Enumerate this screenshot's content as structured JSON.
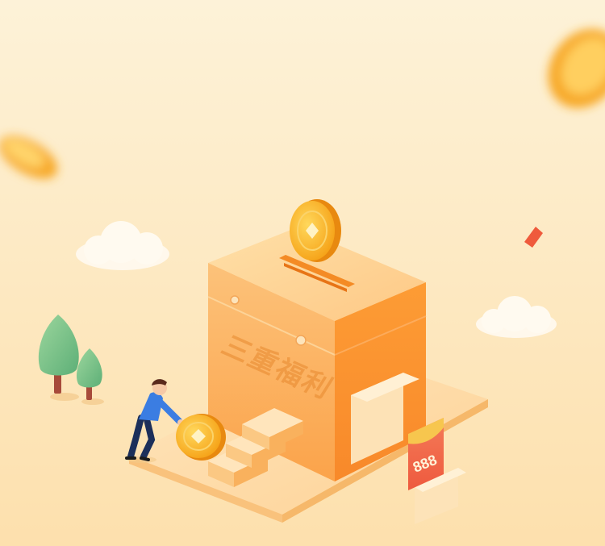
{
  "box": {
    "label": "三重福利"
  },
  "envelope": {
    "label": "888"
  },
  "icons": {
    "coin": "coin-icon",
    "tree": "tree-icon",
    "cloud": "cloud-icon",
    "person": "person-icon",
    "envelope": "red-envelope-icon"
  },
  "colors": {
    "background_top": "#fdf0d4",
    "background_bottom": "#fde3b0",
    "box_front": "#fcb264",
    "box_side": "#fb9733",
    "coin": "#f7a91c",
    "envelope": "#f1674a",
    "tree": "#7fc389",
    "person_shirt": "#3b7de2"
  }
}
